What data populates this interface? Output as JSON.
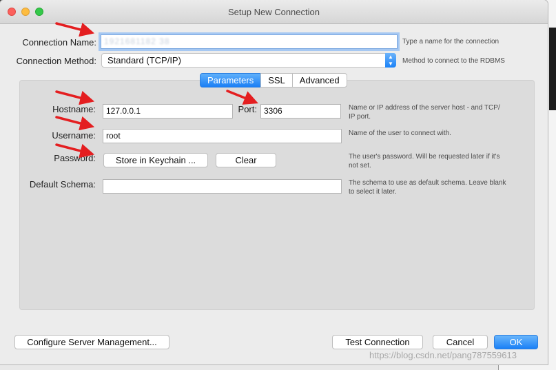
{
  "window": {
    "title": "Setup New Connection"
  },
  "connection": {
    "name_label": "Connection Name:",
    "name_value": "1921681182 38",
    "name_help": "Type a name for the connection",
    "method_label": "Connection Method:",
    "method_value": "Standard (TCP/IP)",
    "method_help": "Method to connect to the RDBMS"
  },
  "tabs": [
    {
      "label": "Parameters",
      "active": true
    },
    {
      "label": "SSL",
      "active": false
    },
    {
      "label": "Advanced",
      "active": false
    }
  ],
  "params": {
    "hostname_label": "Hostname:",
    "hostname_value": "127.0.0.1",
    "port_label": "Port:",
    "port_value": "3306",
    "hostname_help_1": "Name or IP address of the server host - and TCP/",
    "hostname_help_2": "IP port.",
    "username_label": "Username:",
    "username_value": "root",
    "username_help": "Name of the user to connect with.",
    "password_label": "Password:",
    "store_keychain": "Store in Keychain ...",
    "clear": "Clear",
    "password_help_1": "The user's password. Will be requested later if it's",
    "password_help_2": "not set.",
    "schema_label": "Default Schema:",
    "schema_value": "",
    "schema_help_1": "The schema to use as default schema. Leave blank",
    "schema_help_2": "to select it later."
  },
  "footer": {
    "configure": "Configure Server Management...",
    "test": "Test Connection",
    "cancel": "Cancel",
    "ok": "OK"
  },
  "watermark": "https://blog.csdn.net/pang787559613",
  "colors": {
    "accent": "#1a80f6",
    "annotation_arrow": "#e41e20"
  }
}
